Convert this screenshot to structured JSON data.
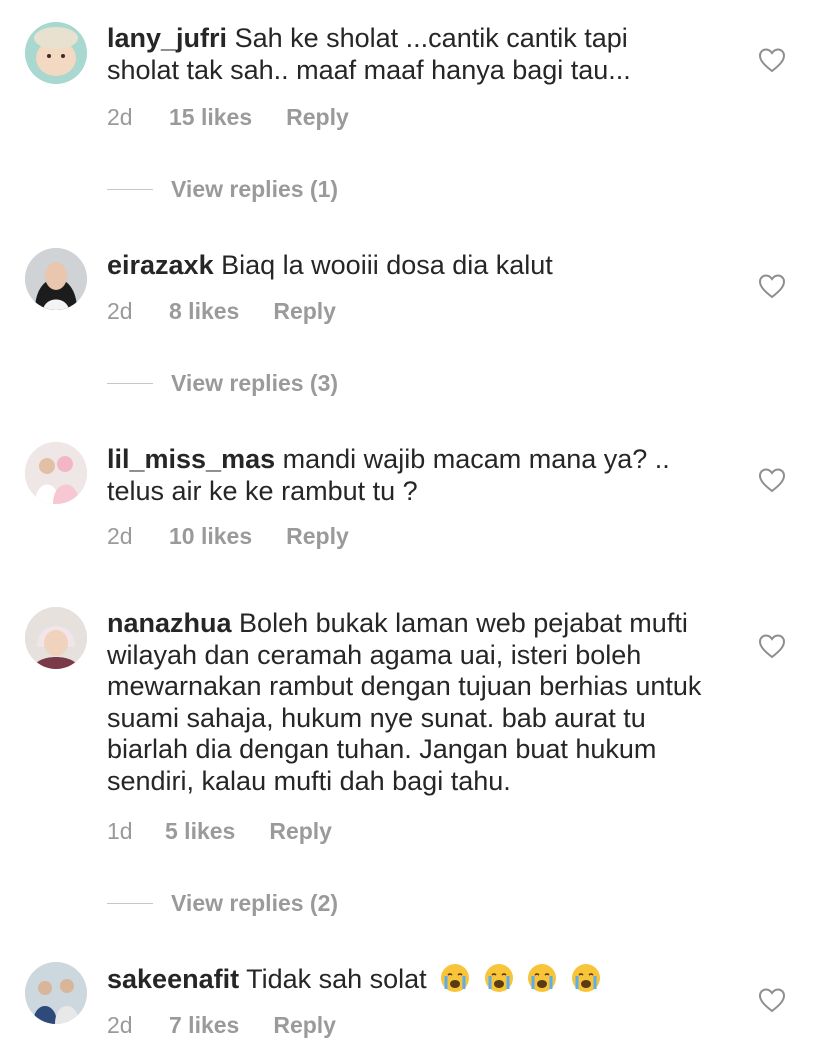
{
  "comments": [
    {
      "username": "lany_jufri",
      "text": "Sah ke sholat ...cantik cantik tapi sholat tak sah.. maaf  maaf hanya bagi tau...",
      "time": "2d",
      "likes": "15 likes",
      "reply": "Reply",
      "view_replies": "View replies (1)",
      "avatar_icon": "baby-avatar"
    },
    {
      "username": "eirazaxk",
      "text": "Biaq la wooiii dosa dia kalut",
      "time": "2d",
      "likes": "8 likes",
      "reply": "Reply",
      "view_replies": "View replies (3)",
      "avatar_icon": "woman-avatar"
    },
    {
      "username": "lil_miss_mas",
      "text": "mandi wajib macam mana ya? .. telus air ke ke rambut tu ?",
      "time": "2d",
      "likes": "10 likes",
      "reply": "Reply",
      "avatar_icon": "couple-avatar"
    },
    {
      "username": "nanazhua",
      "text": "Boleh bukak laman web pejabat mufti wilayah dan ceramah agama uai, isteri boleh mewarnakan rambut dengan tujuan berhias untuk suami sahaja, hukum nye sunat. bab aurat tu biarlah dia dengan tuhan. Jangan buat hukum sendiri, kalau mufti dah bagi tahu.",
      "time": "1d",
      "likes": "5 likes",
      "reply": "Reply",
      "view_replies": "View replies (2)",
      "avatar_icon": "child-avatar"
    },
    {
      "username": "sakeenafit",
      "text": "Tidak sah solat",
      "emoji": [
        "crying-face-icon",
        "crying-face-icon",
        "crying-face-icon",
        "crying-face-icon"
      ],
      "time": "2d",
      "likes": "7 likes",
      "reply": "Reply",
      "avatar_icon": "family-avatar"
    }
  ],
  "icons": {
    "like": "heart-outline-icon"
  },
  "colors": {
    "text": "#262626",
    "meta": "#9a9a9a",
    "divider": "#c7c7c7"
  }
}
